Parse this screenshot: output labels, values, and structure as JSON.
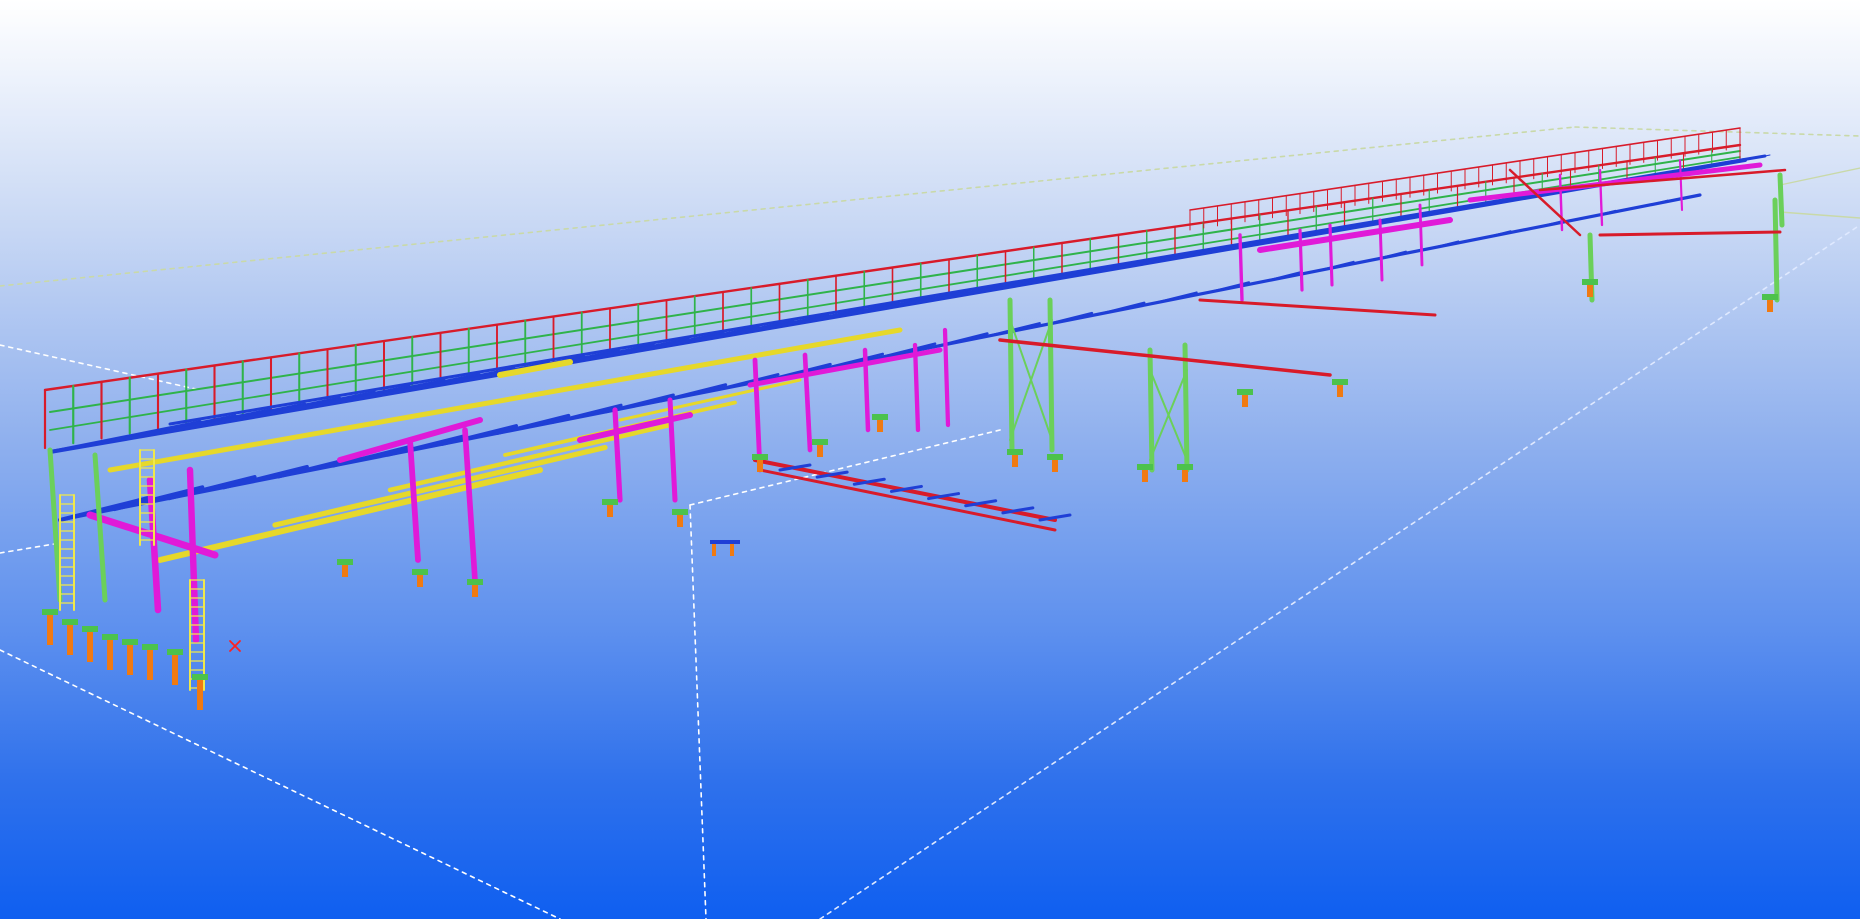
{
  "viewport": {
    "view_type": "3d-perspective",
    "background": {
      "top": "#ffffff",
      "bottom": "#0f5ff0"
    }
  },
  "model": {
    "description_icon": "steel-pipe-rack-structure",
    "colors": {
      "beam_blue": "#1f3fd6",
      "beam_yellow": "#e6d82a",
      "column_magenta": "#e01ad8",
      "railing_red": "#d81b2a",
      "railing_green": "#2fb34a",
      "bracing_green": "#6bd05a",
      "footing_orange": "#f07a12",
      "baseplate_green": "#4cc24c",
      "ladder_yellow": "#f0e84a",
      "grating_gray": "#a7a9b8",
      "bbox_line": "#ffffff"
    }
  },
  "markers": {
    "origin_marker_icon": "red-x-icon",
    "origin_marker_color": "#ff2020"
  }
}
